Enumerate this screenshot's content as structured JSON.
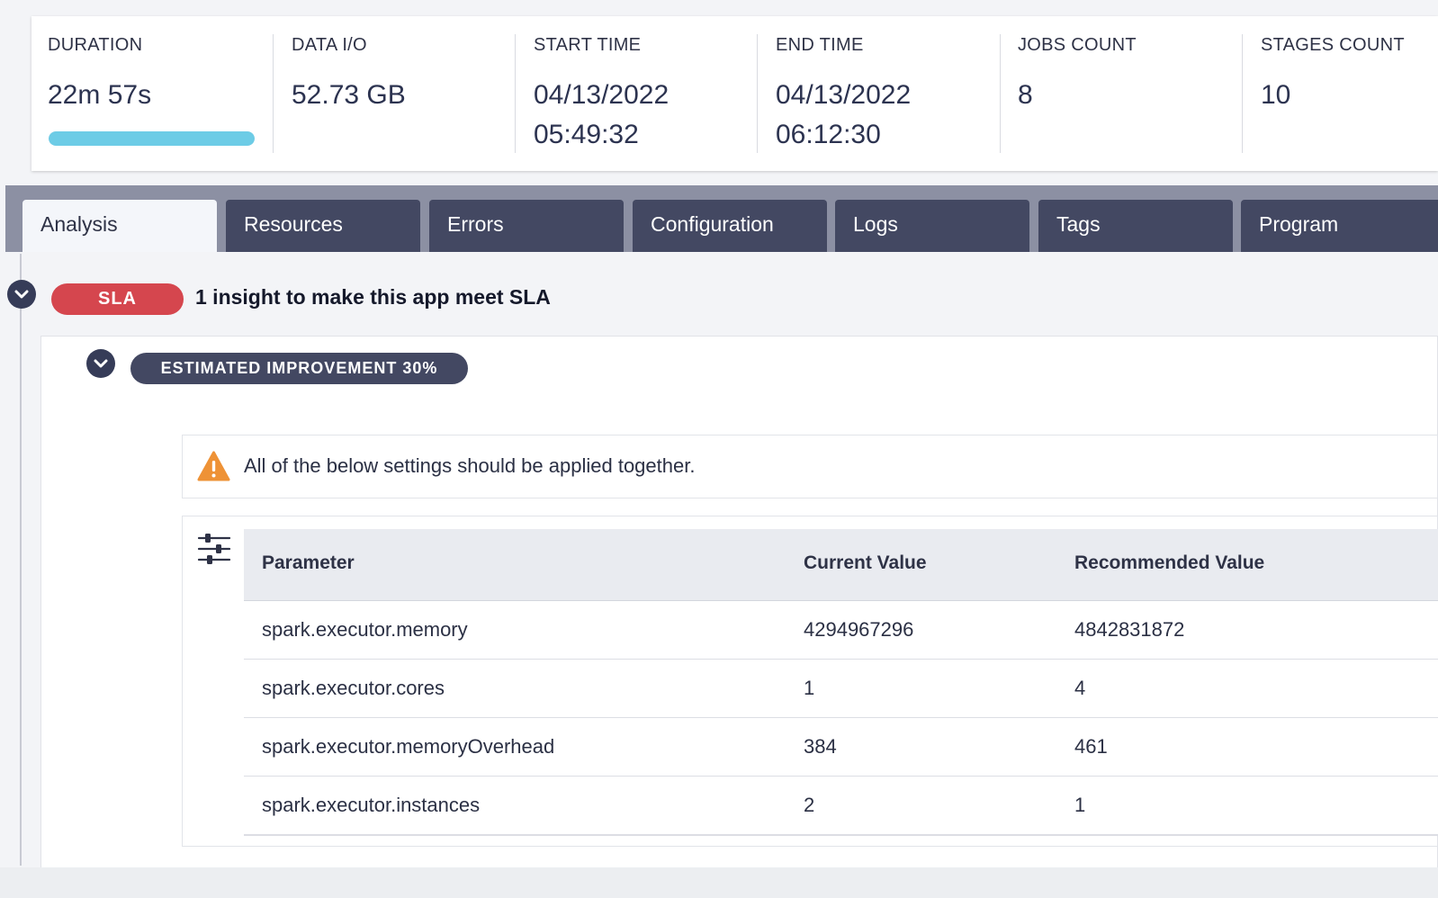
{
  "stats": {
    "duration": {
      "label": "DURATION",
      "value": "22m 57s",
      "progress": 1.0
    },
    "data_io": {
      "label": "DATA I/O",
      "value": "52.73 GB"
    },
    "start_time": {
      "label": "START TIME",
      "date": "04/13/2022",
      "time": "05:49:32"
    },
    "end_time": {
      "label": "END TIME",
      "date": "04/13/2022",
      "time": "06:12:30"
    },
    "jobs_count": {
      "label": "JOBS COUNT",
      "value": "8"
    },
    "stages_count": {
      "label": "STAGES COUNT",
      "value": "10"
    }
  },
  "tabs": [
    {
      "label": "Analysis",
      "active": true
    },
    {
      "label": "Resources"
    },
    {
      "label": "Errors"
    },
    {
      "label": "Configuration"
    },
    {
      "label": "Logs"
    },
    {
      "label": "Tags"
    },
    {
      "label": "Program"
    }
  ],
  "insight": {
    "badge": "SLA",
    "title": "1 insight to make this app meet SLA",
    "improvement": "ESTIMATED IMPROVEMENT 30%",
    "warning": "All of the below settings should be applied together."
  },
  "table": {
    "headers": [
      "Parameter",
      "Current Value",
      "Recommended Value"
    ],
    "rows": [
      [
        "spark.executor.memory",
        "4294967296",
        "4842831872"
      ],
      [
        "spark.executor.cores",
        "1",
        "4"
      ],
      [
        "spark.executor.memoryOverhead",
        "384",
        "461"
      ],
      [
        "spark.executor.instances",
        "2",
        "1"
      ]
    ]
  },
  "icons": {
    "collapse": "chevron-down-icon",
    "warning": "warning-triangle-icon",
    "settings": "sliders-icon"
  },
  "colors": {
    "sla": "#d5464e",
    "progress": "#6dcce6",
    "tab_inactive": "#434862",
    "warning": "#ee9236"
  }
}
